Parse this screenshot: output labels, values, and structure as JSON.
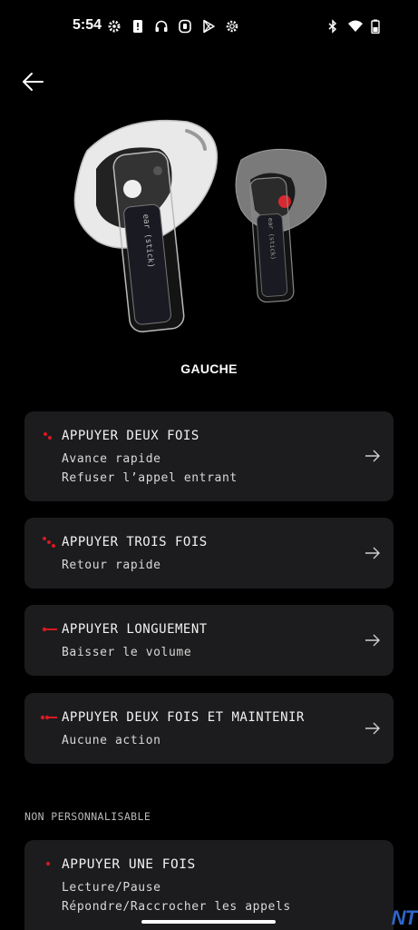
{
  "status": {
    "time": "5:54",
    "left_icons": [
      "settings-icon",
      "alert-icon",
      "headphones-icon",
      "nothing-app-icon",
      "play-store-icon",
      "settings-icon"
    ],
    "right_icons": [
      "bluetooth-icon",
      "wifi-icon",
      "battery-icon"
    ]
  },
  "earbud_side": "GAUCHE",
  "gestures": [
    {
      "label": "APPUYER DEUX FOIS",
      "lines": [
        "Avance rapide",
        "Refuser l’appel entrant"
      ],
      "indicator": "two-taps"
    },
    {
      "label": "APPUYER TROIS FOIS",
      "lines": [
        "Retour rapide"
      ],
      "indicator": "three-taps"
    },
    {
      "label": "APPUYER LONGUEMENT",
      "lines": [
        "Baisser le volume"
      ],
      "indicator": "long-press"
    },
    {
      "label": "APPUYER DEUX FOIS ET MAINTENIR",
      "lines": [
        "Aucune action"
      ],
      "indicator": "double-tap-hold"
    }
  ],
  "fixed_section": {
    "title": "NON PERSONNALISABLE",
    "items": [
      {
        "label": "APPUYER UNE FOIS",
        "lines": [
          "Lecture/Pause",
          "Répondre/Raccrocher les appels"
        ],
        "indicator": "one-tap"
      }
    ]
  },
  "watermark": "NT",
  "colors": {
    "background": "#000000",
    "card": "#1c1c1e",
    "accent_red": "#d71921"
  }
}
